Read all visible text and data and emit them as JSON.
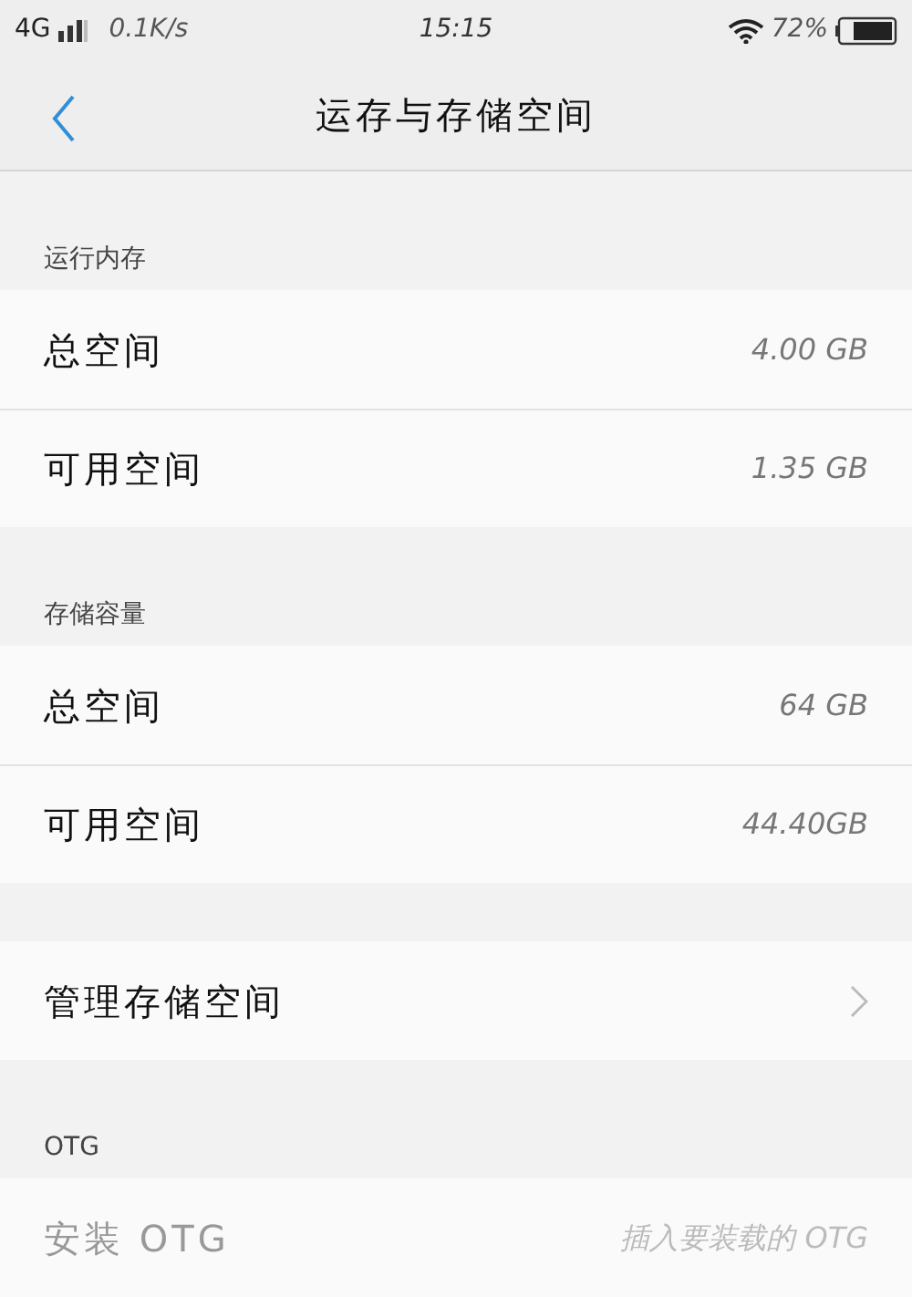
{
  "status_bar": {
    "network": "4G",
    "speed": "0.1K/s",
    "time": "15:15",
    "battery": "72%"
  },
  "header": {
    "title": "运存与存储空间"
  },
  "sections": [
    {
      "title": "运行内存",
      "items": [
        {
          "kind": "info",
          "label": "总空间",
          "value": "4.00 GB",
          "disabled": false
        },
        {
          "kind": "info",
          "label": "可用空间",
          "value": "1.35 GB",
          "disabled": false
        }
      ]
    },
    {
      "title": "存储容量",
      "items": [
        {
          "kind": "info",
          "label": "总空间",
          "value": "64 GB",
          "disabled": false
        },
        {
          "kind": "info",
          "label": "可用空间",
          "value": "44.40GB",
          "disabled": false
        }
      ]
    },
    {
      "items": [
        {
          "kind": "link",
          "label": "管理存储空间",
          "disabled": false
        }
      ]
    },
    {
      "title": "OTG",
      "items": [
        {
          "kind": "info",
          "label": "安装 OTG",
          "value": "插入要装载的 OTG",
          "disabled": true
        }
      ]
    }
  ]
}
